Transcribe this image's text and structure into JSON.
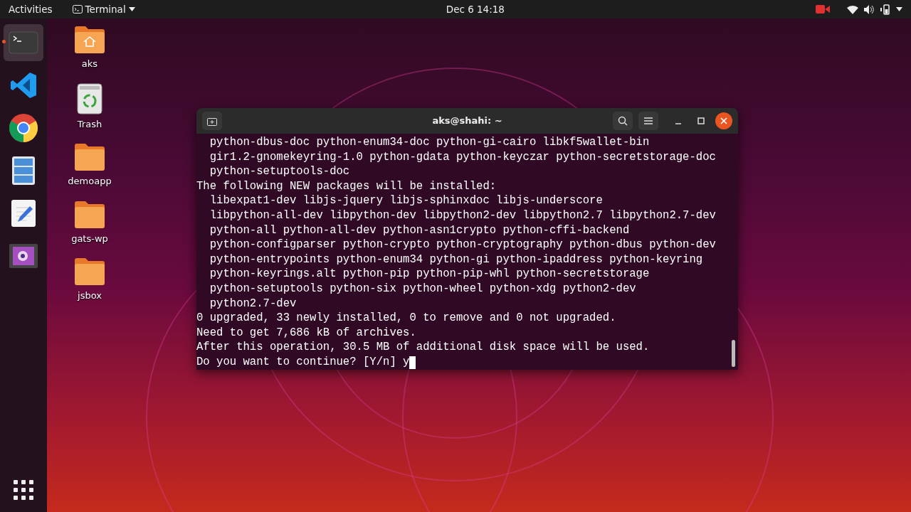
{
  "top_bar": {
    "activities": "Activities",
    "app_menu": "Terminal",
    "clock": "Dec 6  14:18"
  },
  "dock": [
    {
      "kind": "terminal",
      "selected": true,
      "running": true
    },
    {
      "kind": "code-editor",
      "selected": false,
      "running": false
    },
    {
      "kind": "browser",
      "selected": false,
      "running": false
    },
    {
      "kind": "files",
      "selected": false,
      "running": false
    },
    {
      "kind": "text-editor",
      "selected": false,
      "running": false
    },
    {
      "kind": "video",
      "selected": false,
      "running": false
    }
  ],
  "desktop_icons": [
    {
      "kind": "home",
      "label": "aks"
    },
    {
      "kind": "trash",
      "label": "Trash"
    },
    {
      "kind": "folder",
      "label": "demoapp"
    },
    {
      "kind": "folder",
      "label": "gats-wp"
    },
    {
      "kind": "folder",
      "label": "jsbox"
    }
  ],
  "terminal": {
    "title": "aks@shahi: ~",
    "lines": [
      "  python-dbus-doc python-enum34-doc python-gi-cairo libkf5wallet-bin",
      "  gir1.2-gnomekeyring-1.0 python-gdata python-keyczar python-secretstorage-doc",
      "  python-setuptools-doc",
      "The following NEW packages will be installed:",
      "  libexpat1-dev libjs-jquery libjs-sphinxdoc libjs-underscore",
      "  libpython-all-dev libpython-dev libpython2-dev libpython2.7 libpython2.7-dev",
      "  python-all python-all-dev python-asn1crypto python-cffi-backend",
      "  python-configparser python-crypto python-cryptography python-dbus python-dev",
      "  python-entrypoints python-enum34 python-gi python-ipaddress python-keyring",
      "  python-keyrings.alt python-pip python-pip-whl python-secretstorage",
      "  python-setuptools python-six python-wheel python-xdg python2-dev",
      "  python2.7-dev",
      "0 upgraded, 33 newly installed, 0 to remove and 0 not upgraded.",
      "Need to get 7,686 kB of archives.",
      "After this operation, 30.5 MB of additional disk space will be used.",
      "Do you want to continue? [Y/n] y"
    ]
  }
}
